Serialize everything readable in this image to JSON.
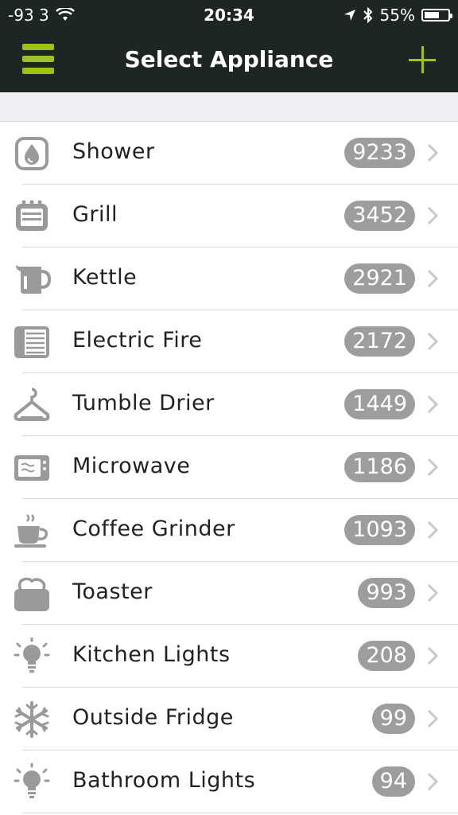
{
  "status_bar": {
    "signal": "-93 3",
    "time": "20:34",
    "battery": "55%"
  },
  "nav": {
    "title": "Select Appliance",
    "menu_icon": "hamburger-menu-icon",
    "add_icon": "plus-icon"
  },
  "colors": {
    "bar_bg": "#1d2622",
    "accent": "#9bc31a",
    "badge": "#9d9d9d"
  },
  "appliances": [
    {
      "name": "Shower",
      "count": "9233",
      "icon": "shower-icon"
    },
    {
      "name": "Grill",
      "count": "3452",
      "icon": "grill-icon"
    },
    {
      "name": "Kettle",
      "count": "2921",
      "icon": "kettle-icon"
    },
    {
      "name": "Electric Fire",
      "count": "2172",
      "icon": "electric-fire-icon"
    },
    {
      "name": "Tumble Drier",
      "count": "1449",
      "icon": "tumble-drier-icon"
    },
    {
      "name": "Microwave",
      "count": "1186",
      "icon": "microwave-icon"
    },
    {
      "name": "Coffee Grinder",
      "count": "1093",
      "icon": "coffee-grinder-icon"
    },
    {
      "name": "Toaster",
      "count": "993",
      "icon": "toaster-icon"
    },
    {
      "name": "Kitchen Lights",
      "count": "208",
      "icon": "light-bulb-icon"
    },
    {
      "name": "Outside Fridge",
      "count": "99",
      "icon": "snowflake-icon"
    },
    {
      "name": "Bathroom Lights",
      "count": "94",
      "icon": "light-bulb-icon"
    }
  ]
}
